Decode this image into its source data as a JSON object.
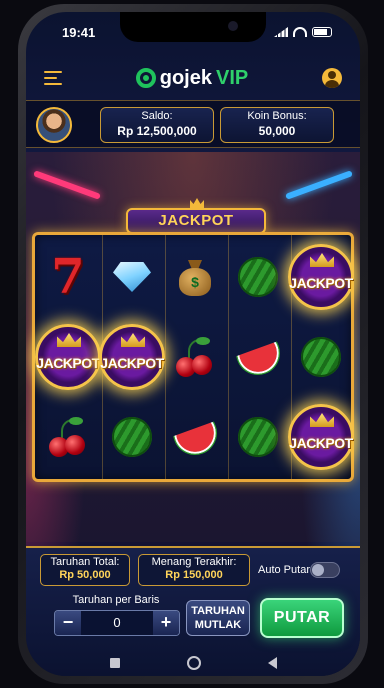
{
  "status": {
    "time": "19:41"
  },
  "brand": {
    "name": "gojek",
    "suffix": "VIP"
  },
  "balance": {
    "saldo_label": "Saldo:",
    "saldo_value": "Rp 12,500,000",
    "koin_label": "Koin Bonus:",
    "koin_value": "50,000"
  },
  "banner": {
    "title": "JACKPOT"
  },
  "reels": [
    [
      "seven",
      "jackpot",
      "cherry"
    ],
    [
      "diamond",
      "jackpot",
      "watermelon"
    ],
    [
      "money-bag",
      "cherry",
      "watermelon-slice"
    ],
    [
      "watermelon",
      "watermelon-slice",
      "watermelon"
    ],
    [
      "jackpot",
      "watermelon",
      "jackpot"
    ]
  ],
  "symbols": {
    "jackpot_text": "JACKPOT",
    "money_sign": "$"
  },
  "controls": {
    "total_bet_label": "Taruhan Total:",
    "total_bet_value": "Rp 50,000",
    "last_win_label": "Menang Terakhir:",
    "last_win_value": "Rp 150,000",
    "auto_spin_label": "Auto Putar",
    "auto_spin_on": false,
    "line_bet_label": "Taruhan per Baris",
    "line_bet_value": "0",
    "minus": "−",
    "plus": "+",
    "max_bet_line1": "TARUHAN",
    "max_bet_line2": "MUTLAK",
    "spin_label": "PUTAR"
  },
  "colors": {
    "gold": "#f4b93a",
    "green": "#1fc25c",
    "navy": "#0b1330"
  }
}
